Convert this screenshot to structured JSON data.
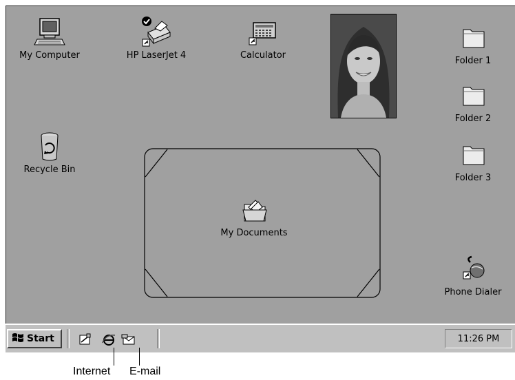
{
  "desktop": {
    "icons": {
      "my_computer": "My Computer",
      "hp_laserjet": "HP LaserJet 4",
      "calculator": "Calculator",
      "folder1": "Folder 1",
      "folder2": "Folder 2",
      "folder3": "Folder 3",
      "recycle_bin": "Recycle Bin",
      "my_documents": "My Documents",
      "phone_dialer": "Phone Dialer"
    }
  },
  "taskbar": {
    "start_label": "Start",
    "clock": "11:26 PM"
  },
  "callouts": {
    "internet": "Internet",
    "email": "E-mail"
  }
}
